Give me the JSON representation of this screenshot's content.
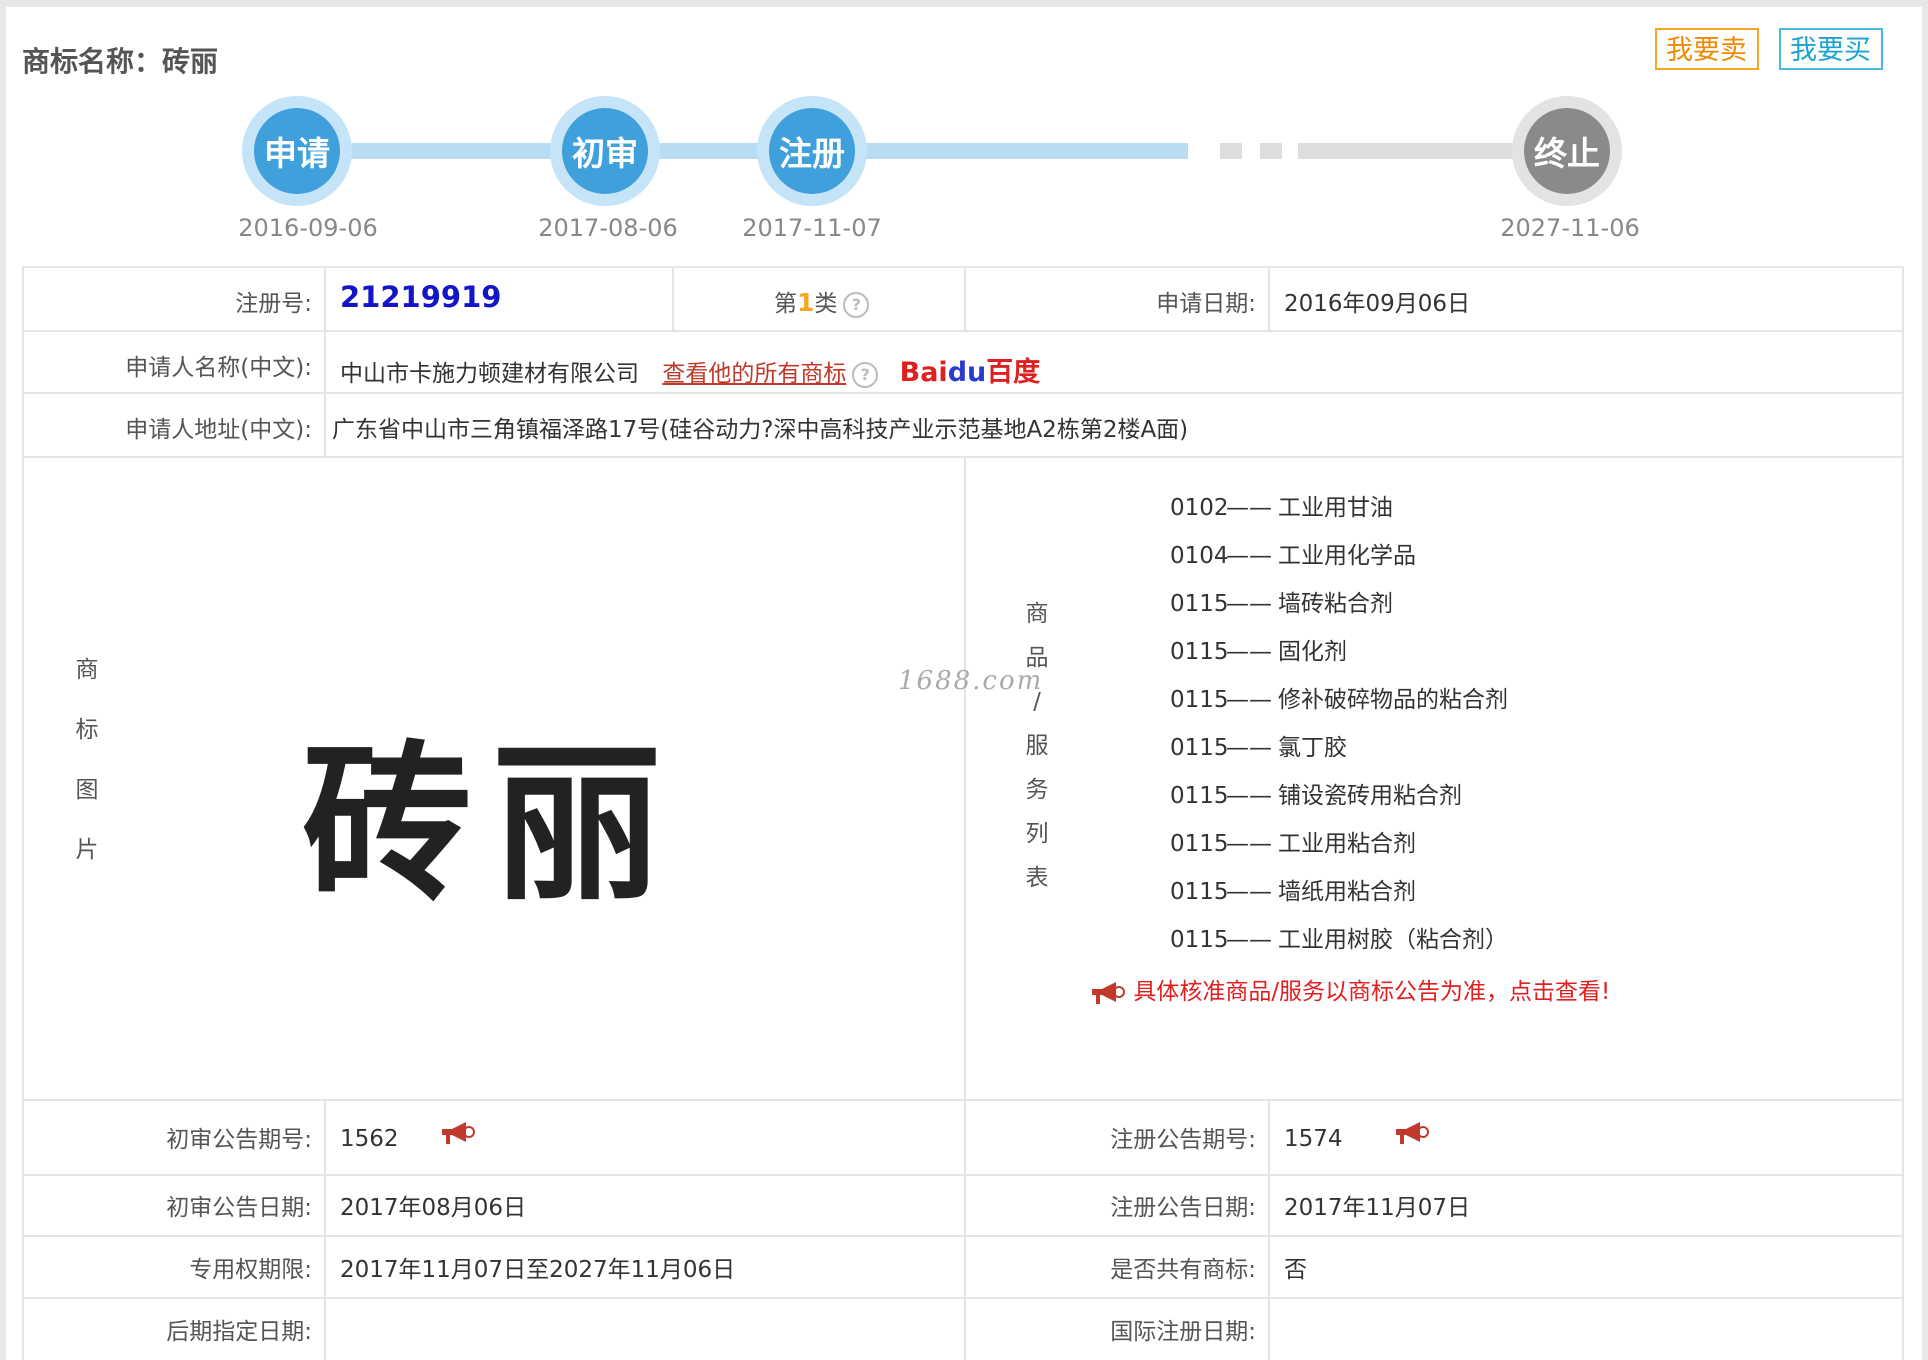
{
  "header": {
    "title": "商标名称：砖丽",
    "sell_label": "我要卖",
    "buy_label": "我要买"
  },
  "timeline": {
    "steps": [
      {
        "label": "申请",
        "date": "2016-09-06",
        "state": "done"
      },
      {
        "label": "初审",
        "date": "2017-08-06",
        "state": "done"
      },
      {
        "label": "注册",
        "date": "2017-11-07",
        "state": "done"
      },
      {
        "label": "终止",
        "date": "2027-11-06",
        "state": "pending"
      }
    ]
  },
  "info": {
    "reg_no_label": "注册号:",
    "reg_no": "21219919",
    "class_prefix": "第",
    "class_num": "1",
    "class_suffix": "类",
    "apply_date_label": "申请日期:",
    "apply_date": "2016年09月06日",
    "applicant_label": "申请人名称(中文):",
    "applicant": "中山市卡施力顿建材有限公司",
    "view_all_link": "查看他的所有商标",
    "baidu_a": "Bai",
    "baidu_b": "du",
    "baidu_c": "百度",
    "address_label": "申请人地址(中文):",
    "address": "广东省中山市三角镇福泽路17号(硅谷动力?深中高科技产业示范基地A2栋第2楼A面)",
    "image_label_chars": [
      "商",
      "标",
      "图",
      "片"
    ],
    "mark_text": "砖丽",
    "watermark": "1688.com",
    "goods_label_chars": [
      "商",
      "品",
      "/",
      "服",
      "务",
      "列",
      "表"
    ]
  },
  "goods": [
    {
      "code": "0102",
      "dash": "——",
      "name": "工业用甘油"
    },
    {
      "code": "0104",
      "dash": "——",
      "name": "工业用化学品"
    },
    {
      "code": "0115",
      "dash": "——",
      "name": "墙砖粘合剂"
    },
    {
      "code": "0115",
      "dash": "——",
      "name": "固化剂"
    },
    {
      "code": "0115",
      "dash": "——",
      "name": "修补破碎物品的粘合剂"
    },
    {
      "code": "0115",
      "dash": "——",
      "name": "氯丁胶"
    },
    {
      "code": "0115",
      "dash": "——",
      "name": "铺设瓷砖用粘合剂"
    },
    {
      "code": "0115",
      "dash": "——",
      "name": "工业用粘合剂"
    },
    {
      "code": "0115",
      "dash": "——",
      "name": "墙纸用粘合剂"
    },
    {
      "code": "0115",
      "dash": "——",
      "name": "工业用树胶（粘合剂）"
    }
  ],
  "notice": "具体核准商品/服务以商标公告为准，点击查看!",
  "bottom": {
    "prelim_no_label": "初审公告期号:",
    "prelim_no": "1562",
    "reg_no_label": "注册公告期号:",
    "reg_no": "1574",
    "prelim_date_label": "初审公告日期:",
    "prelim_date": "2017年08月06日",
    "reg_date_label": "注册公告日期:",
    "reg_date": "2017年11月07日",
    "term_label": "专用权期限:",
    "term": "2017年11月07日至2027年11月06日",
    "shared_label": "是否共有商标:",
    "shared": "否",
    "later_label": "后期指定日期:",
    "later": "",
    "intl_label": "国际注册日期:",
    "intl": ""
  },
  "colors": {
    "accent_blue": "#3fa0dc",
    "sell_orange": "#f5a623",
    "buy_cyan": "#49b9e4",
    "notice_red": "#e02020",
    "reg_no_blue": "#1414c8"
  }
}
